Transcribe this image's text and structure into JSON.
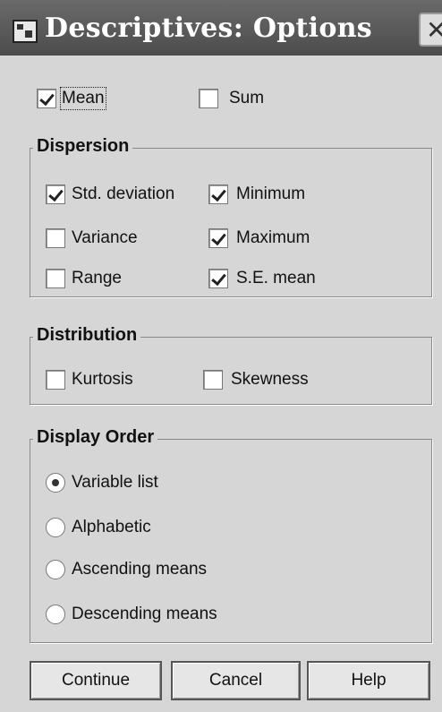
{
  "window": {
    "title": "Descriptives: Options",
    "close_glyph": "✕"
  },
  "options": {
    "mean": {
      "label": "Mean",
      "checked": true
    },
    "sum": {
      "label": "Sum",
      "checked": false
    }
  },
  "dispersion": {
    "legend": "Dispersion",
    "std_deviation": {
      "label": "Std. deviation",
      "checked": true
    },
    "minimum": {
      "label": "Minimum",
      "checked": true
    },
    "variance": {
      "label": "Variance",
      "checked": false
    },
    "maximum": {
      "label": "Maximum",
      "checked": true
    },
    "range": {
      "label": "Range",
      "checked": false
    },
    "se_mean": {
      "label": "S.E. mean",
      "checked": true
    }
  },
  "distribution": {
    "legend": "Distribution",
    "kurtosis": {
      "label": "Kurtosis",
      "checked": false
    },
    "skewness": {
      "label": "Skewness",
      "checked": false
    }
  },
  "display_order": {
    "legend": "Display Order",
    "selected": "Variable list",
    "options": [
      "Variable list",
      "Alphabetic",
      "Ascending means",
      "Descending means"
    ]
  },
  "buttons": {
    "continue": "Continue",
    "cancel": "Cancel",
    "help": "Help"
  },
  "icons": {
    "title_icon": "descriptives-window-icon",
    "close_icon": "close-icon"
  }
}
